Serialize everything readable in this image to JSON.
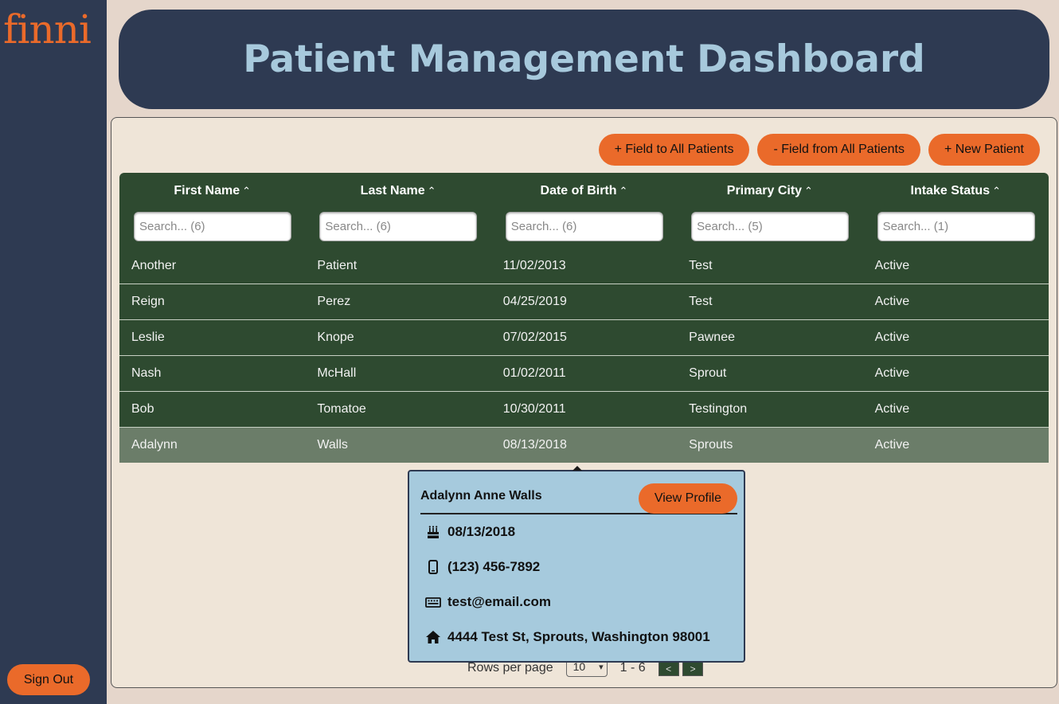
{
  "app": {
    "logo": "finni",
    "title": "Patient Management Dashboard",
    "sign_out": "Sign Out"
  },
  "actions": {
    "add_field": "+ Field to All Patients",
    "remove_field": "- Field from All Patients",
    "new_patient": "+ New Patient"
  },
  "table": {
    "columns": [
      {
        "label": "First Name",
        "placeholder": "Search... (6)"
      },
      {
        "label": "Last Name",
        "placeholder": "Search... (6)"
      },
      {
        "label": "Date of Birth",
        "placeholder": "Search... (6)"
      },
      {
        "label": "Primary City",
        "placeholder": "Search... (5)"
      },
      {
        "label": "Intake Status",
        "placeholder": "Search... (1)"
      }
    ],
    "sort_icon": "⌃⌄",
    "rows": [
      [
        "Another",
        "Patient",
        "11/02/2013",
        "Test",
        "Active"
      ],
      [
        "Reign",
        "Perez",
        "04/25/2019",
        "Test",
        "Active"
      ],
      [
        "Leslie",
        "Knope",
        "07/02/2015",
        "Pawnee",
        "Active"
      ],
      [
        "Nash",
        "McHall",
        "01/02/2011",
        "Sprout",
        "Active"
      ],
      [
        "Bob",
        "Tomatoe",
        "10/30/2011",
        "Testington",
        "Active"
      ],
      [
        "Adalynn",
        "Walls",
        "08/13/2018",
        "Sprouts",
        "Active"
      ]
    ]
  },
  "pagination": {
    "rows_per_page_label": "Rows per page",
    "rows_per_page": "10",
    "range": "1 - 6",
    "prev": "<",
    "next": ">"
  },
  "popover": {
    "name": "Adalynn Anne Walls",
    "view_profile": "View Profile",
    "dob": "08/13/2018",
    "phone": "(123) 456-7892",
    "email": "test@email.com",
    "address": "4444 Test St, Sprouts, Washington 98001"
  },
  "colors": {
    "accent": "#ea6a2a",
    "navy": "#2e3a52",
    "table_green": "#2e4a30",
    "popover_blue": "#a6cadd"
  }
}
